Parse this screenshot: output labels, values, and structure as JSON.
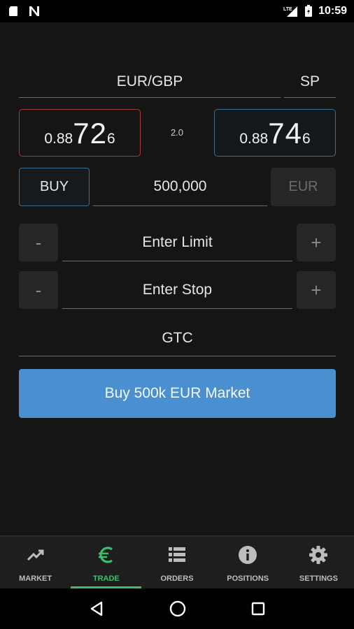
{
  "status_bar": {
    "time": "10:59",
    "left_icons": [
      "sd-card-icon",
      "notification-n-icon"
    ],
    "right_icons": [
      "lte-signal-icon",
      "battery-icon"
    ],
    "network_label": "LTE"
  },
  "trade": {
    "instrument": "EUR/GBP",
    "account_type": "SP",
    "bid": {
      "prefix": "0.88",
      "pips": "72",
      "fraction": "6"
    },
    "spread": "2.0",
    "ask": {
      "prefix": "0.88",
      "pips": "74",
      "fraction": "6"
    },
    "side_label": "BUY",
    "quantity": "500,000",
    "currency_label": "EUR",
    "limit_placeholder": "Enter Limit",
    "stop_placeholder": "Enter Stop",
    "minus_label": "-",
    "plus_label": "+",
    "tif_label": "GTC",
    "submit_label": "Buy 500k EUR Market"
  },
  "colors": {
    "bid_border": "#a33a34",
    "ask_border": "#3d6e8f",
    "submit_bg": "#4a8fcf",
    "active_tab": "#3bbf6a"
  },
  "nav": {
    "items": [
      {
        "label": "MARKET",
        "icon": "trending-up-icon",
        "active": false
      },
      {
        "label": "TRADE",
        "icon": "euro-icon",
        "active": true
      },
      {
        "label": "ORDERS",
        "icon": "list-icon",
        "active": false
      },
      {
        "label": "POSITIONS",
        "icon": "info-icon",
        "active": false
      },
      {
        "label": "SETTINGS",
        "icon": "gear-icon",
        "active": false
      }
    ]
  },
  "system_nav": [
    "back-icon",
    "home-icon",
    "recents-icon"
  ]
}
